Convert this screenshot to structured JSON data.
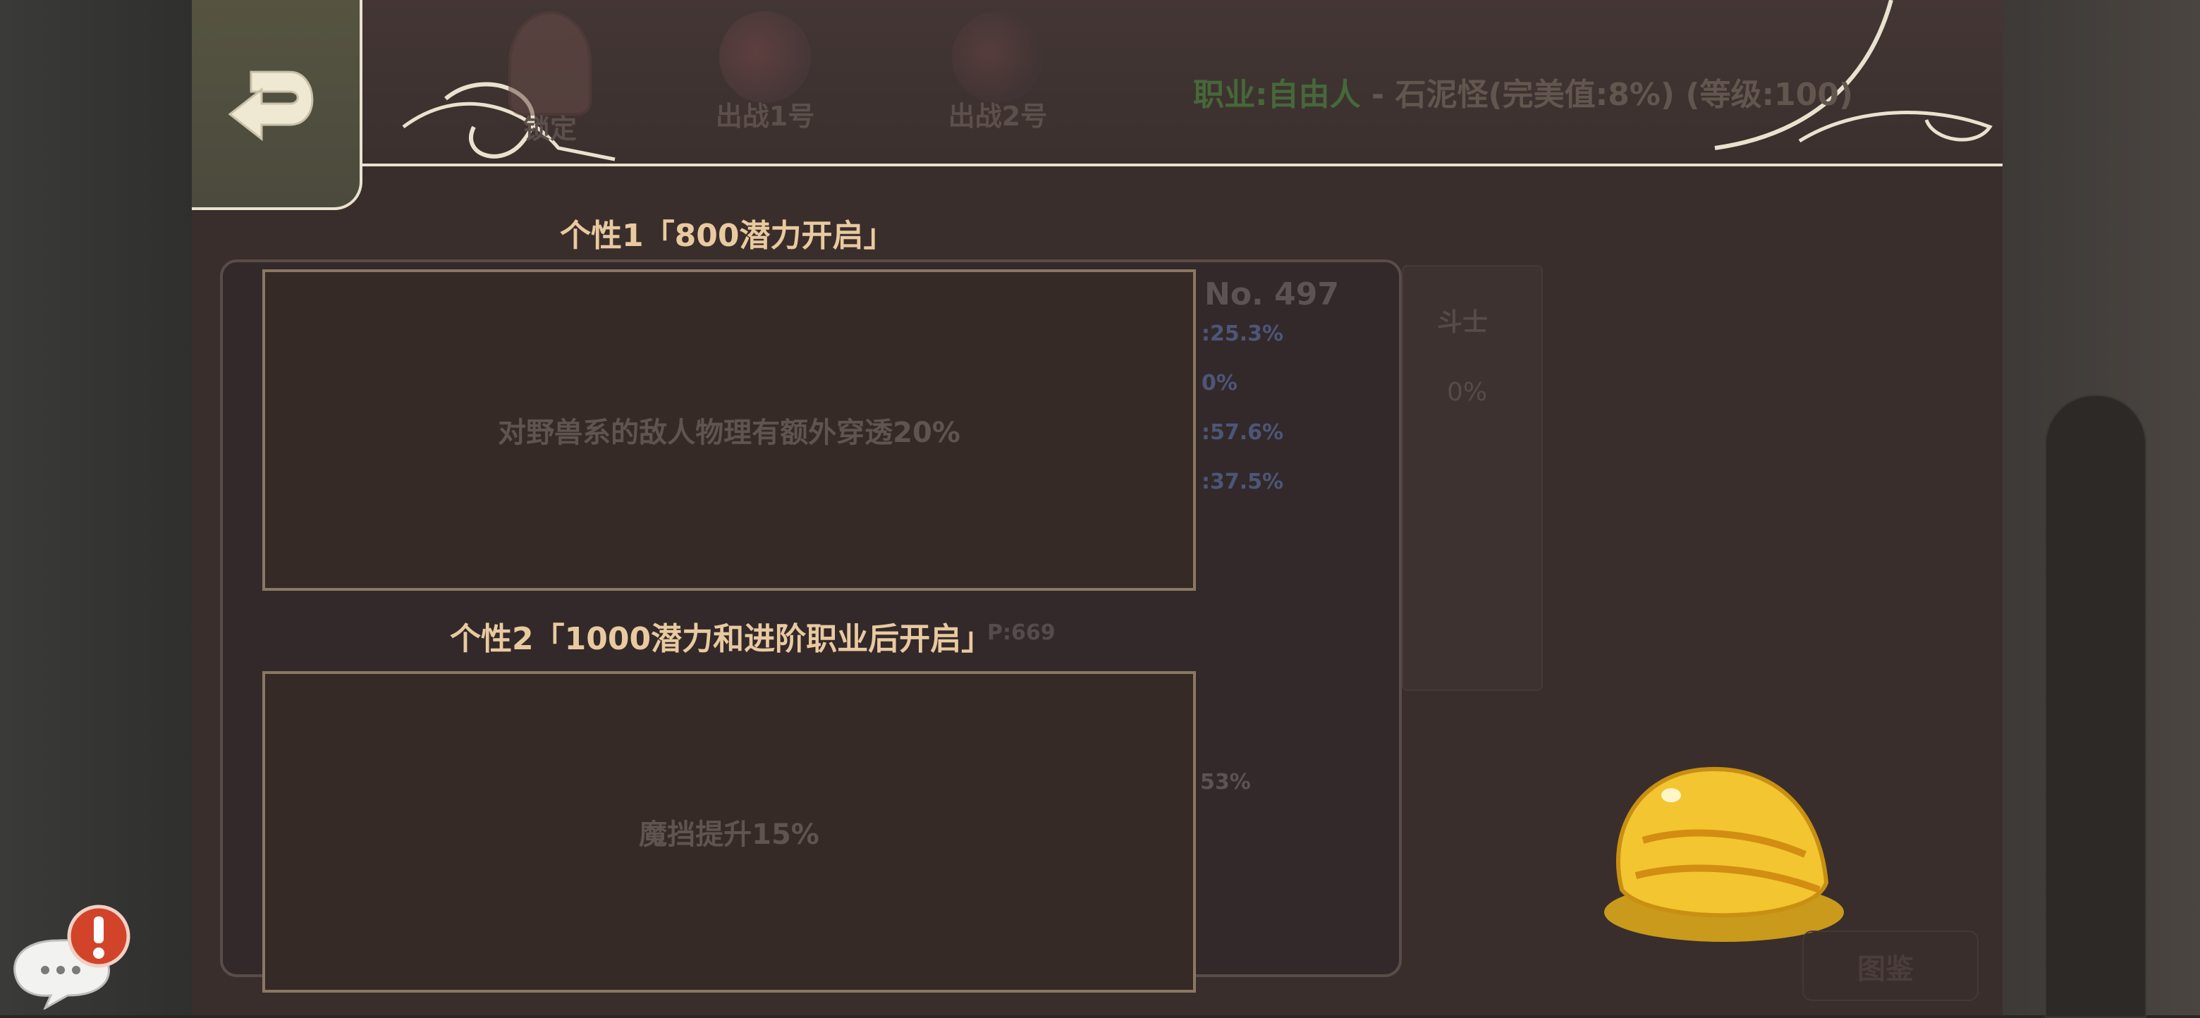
{
  "header": {
    "tabs": [
      {
        "label": "锁定",
        "icon": "lock-icon"
      },
      {
        "label": "出战1号",
        "icon": "hero-portrait-icon"
      },
      {
        "label": "出战2号",
        "icon": "hero-portrait-icon"
      }
    ],
    "job_prefix": "职业:自由人",
    "job_detail": " - 石泥怪(完美值:8%) (等级:100)"
  },
  "background_card": {
    "number": "No. 497",
    "stats": [
      ":25.3%",
      "0%",
      ":57.6%",
      ":37.5%"
    ],
    "hp": "P:669",
    "rate": "53%",
    "class_label": "斗士",
    "class_value": "0%",
    "button": "图鉴"
  },
  "traits": [
    {
      "title": "个性1「800潜力开启」",
      "description": "对野兽系的敌人物理有额外穿透20%"
    },
    {
      "title": "个性2「1000潜力和进阶职业后开启」",
      "description": "魔挡提升15%"
    }
  ],
  "colors": {
    "title_text": "#e9caa0",
    "job_green": "#46683a",
    "frame_border": "#8a7863",
    "alert_red": "#d2442a"
  },
  "icons": {
    "back": "back-arrow-icon",
    "chat": "chat-bubble-icon",
    "alert": "exclamation-icon",
    "item": "gold-slime-icon"
  }
}
